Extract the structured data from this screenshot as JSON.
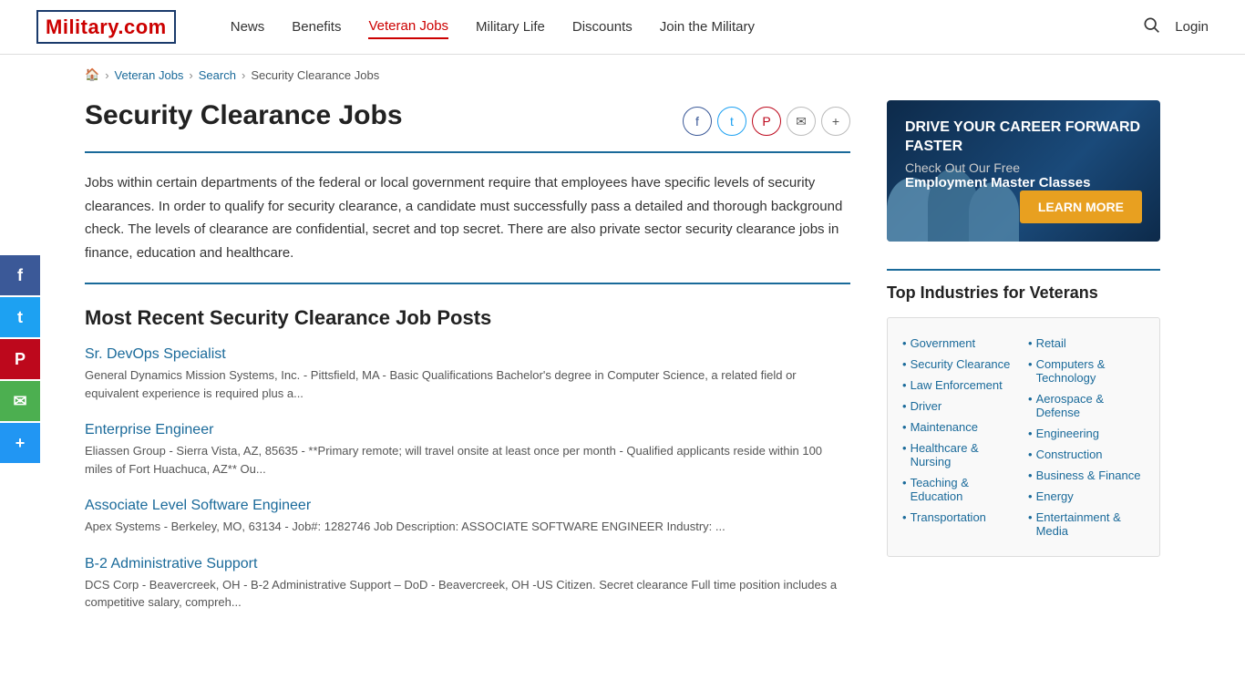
{
  "header": {
    "logo_text": "Military",
    "logo_com": ".com",
    "nav_items": [
      {
        "label": "News",
        "active": false
      },
      {
        "label": "Benefits",
        "active": false
      },
      {
        "label": "Veteran Jobs",
        "active": true
      },
      {
        "label": "Military Life",
        "active": false
      },
      {
        "label": "Discounts",
        "active": false
      },
      {
        "label": "Join the Military",
        "active": false
      }
    ],
    "login_label": "Login"
  },
  "breadcrumb": {
    "home": "🏠",
    "items": [
      {
        "label": "Veteran Jobs",
        "link": true
      },
      {
        "label": "Search",
        "link": true
      },
      {
        "label": "Security Clearance Jobs",
        "link": false
      }
    ]
  },
  "page": {
    "title": "Security Clearance Jobs",
    "description": "Jobs within certain departments of the federal or local government require that employees have specific levels of security clearances. In order to qualify for security clearance, a candidate must successfully pass a detailed and thorough background check. The levels of clearance are confidential, secret and top secret. There are also private sector security clearance jobs in finance, education and healthcare.",
    "jobs_section_title": "Most Recent Security Clearance Job Posts",
    "jobs": [
      {
        "title": "Sr. DevOps Specialist",
        "description": "General Dynamics Mission Systems, Inc. - Pittsfield, MA - Basic Qualifications Bachelor's degree in Computer Science, a related field or equivalent experience is required plus a..."
      },
      {
        "title": "Enterprise Engineer",
        "description": "Eliassen Group - Sierra Vista, AZ, 85635 - **Primary remote; will travel onsite at least once per month - Qualified applicants reside within 100 miles of Fort Huachuca, AZ** Ou..."
      },
      {
        "title": "Associate Level Software Engineer",
        "description": "Apex Systems - Berkeley, MO, 63134 - Job#: 1282746 Job Description: ASSOCIATE SOFTWARE ENGINEER Industry: ..."
      },
      {
        "title": "B-2 Administrative Support",
        "description": "DCS Corp - Beavercreek, OH - B-2 Administrative Support – DoD - Beavercreek, OH -US Citizen. Secret clearance Full time position includes a competitive salary, compreh..."
      }
    ]
  },
  "ad": {
    "headline": "DRIVE YOUR CAREER FORWARD FASTER",
    "sub1": "Check Out Our Free",
    "sub2": "Employment Master Classes",
    "cta": "LEARN MORE"
  },
  "sidebar": {
    "section_title": "Top Industries for Veterans",
    "industries_left": [
      "Government",
      "Security Clearance",
      "Law Enforcement",
      "Driver",
      "Maintenance",
      "Healthcare & Nursing",
      "Teaching & Education",
      "Transportation"
    ],
    "industries_right": [
      "Retail",
      "Computers & Technology",
      "Aerospace & Defense",
      "Engineering",
      "Construction",
      "Business & Finance",
      "Energy",
      "Entertainment & Media"
    ]
  },
  "social": {
    "buttons": [
      {
        "label": "f",
        "class": "fb"
      },
      {
        "label": "t",
        "class": "tw"
      },
      {
        "label": "P",
        "class": "pt"
      },
      {
        "label": "✉",
        "class": "em"
      },
      {
        "label": "+",
        "class": "sh"
      }
    ]
  },
  "share_icons": [
    {
      "symbol": "f",
      "title": "Facebook"
    },
    {
      "symbol": "t",
      "title": "Twitter"
    },
    {
      "symbol": "p",
      "title": "Pinterest"
    },
    {
      "symbol": "✉",
      "title": "Email"
    },
    {
      "symbol": "+",
      "title": "More"
    }
  ]
}
